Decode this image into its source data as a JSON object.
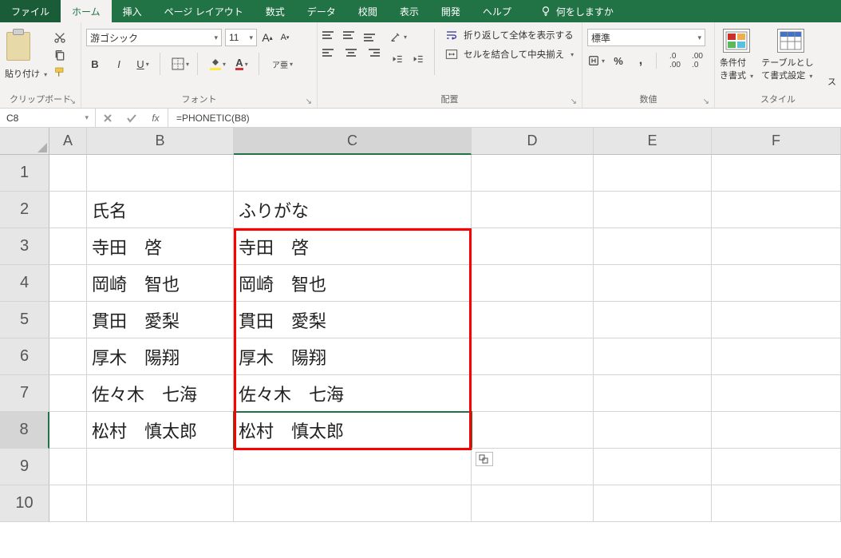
{
  "tabs": {
    "file": "ファイル",
    "home": "ホーム",
    "insert": "挿入",
    "pageLayout": "ページ レイアウト",
    "formulas": "数式",
    "data": "データ",
    "review": "校閲",
    "view": "表示",
    "developer": "開発",
    "help": "ヘルプ",
    "tellme": "何をしますか"
  },
  "ribbon": {
    "clipboard": {
      "label": "クリップボード",
      "paste": "貼り付け"
    },
    "font": {
      "label": "フォント",
      "name": "游ゴシック",
      "size": "11",
      "bold": "B",
      "italic": "I",
      "underline": "U",
      "phonetic": "ア亜"
    },
    "alignment": {
      "label": "配置",
      "wrap": "折り返して全体を表示する",
      "merge": "セルを結合して中央揃え"
    },
    "number": {
      "label": "数値",
      "format": "標準"
    },
    "styles": {
      "label": "スタイル",
      "cond": "条件付き書式",
      "table": "テーブルとして書式設定",
      "right_cut": "ス"
    }
  },
  "nameBox": "C8",
  "formula": "=PHONETIC(B8)",
  "columns": [
    "A",
    "B",
    "C",
    "D",
    "E",
    "F"
  ],
  "rows": [
    "1",
    "2",
    "3",
    "4",
    "5",
    "6",
    "7",
    "8",
    "9",
    "10"
  ],
  "cells": {
    "B2": "氏名",
    "C2": "ふりがな",
    "B3": "寺田　啓",
    "C3": "寺田　啓",
    "B4": "岡崎　智也",
    "C4": "岡崎　智也",
    "B5": "貫田　愛梨",
    "C5": "貫田　愛梨",
    "B6": "厚木　陽翔",
    "C6": "厚木　陽翔",
    "B7": "佐々木　七海",
    "C7": "佐々木　七海",
    "B8": "松村　慎太郎",
    "C8": "松村　慎太郎"
  },
  "selectedCell": "C8",
  "selectedCol": "C",
  "selectedRow": "8"
}
